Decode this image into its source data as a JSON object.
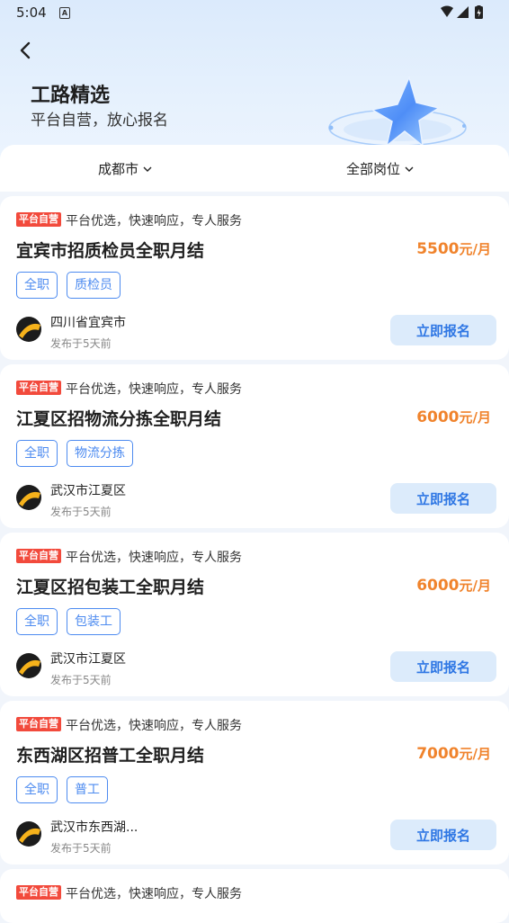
{
  "status_bar": {
    "time": "5:04",
    "notification_letter": "A"
  },
  "header": {
    "title": "工路精选",
    "subtitle": "平台自营，放心报名"
  },
  "filters": {
    "city": "成都市",
    "position": "全部岗位"
  },
  "colors": {
    "accent": "#2f77e4",
    "salary": "#f0832c",
    "badge": "#f24a3c",
    "tag": "#4d8bf0"
  },
  "jobs": [
    {
      "badge": "平台自营",
      "slogan": "平台优选，快速响应，专人服务",
      "title": "宜宾市招质检员全职月结",
      "salary_amount": "5500",
      "salary_unit": "元/月",
      "tags": [
        "全职",
        "质检员"
      ],
      "location": "四川省宜宾市",
      "posted": "发布于5天前",
      "apply_label": "立即报名"
    },
    {
      "badge": "平台自营",
      "slogan": "平台优选，快速响应，专人服务",
      "title": "江夏区招物流分拣全职月结",
      "salary_amount": "6000",
      "salary_unit": "元/月",
      "tags": [
        "全职",
        "物流分拣"
      ],
      "location": "武汉市江夏区",
      "posted": "发布于5天前",
      "apply_label": "立即报名"
    },
    {
      "badge": "平台自营",
      "slogan": "平台优选，快速响应，专人服务",
      "title": "江夏区招包装工全职月结",
      "salary_amount": "6000",
      "salary_unit": "元/月",
      "tags": [
        "全职",
        "包装工"
      ],
      "location": "武汉市江夏区",
      "posted": "发布于5天前",
      "apply_label": "立即报名"
    },
    {
      "badge": "平台自营",
      "slogan": "平台优选，快速响应，专人服务",
      "title": "东西湖区招普工全职月结",
      "salary_amount": "7000",
      "salary_unit": "元/月",
      "tags": [
        "全职",
        "普工"
      ],
      "location": "武汉市东西湖...",
      "posted": "发布于5天前",
      "apply_label": "立即报名"
    },
    {
      "badge": "平台自营",
      "slogan": "平台优选，快速响应，专人服务"
    }
  ]
}
